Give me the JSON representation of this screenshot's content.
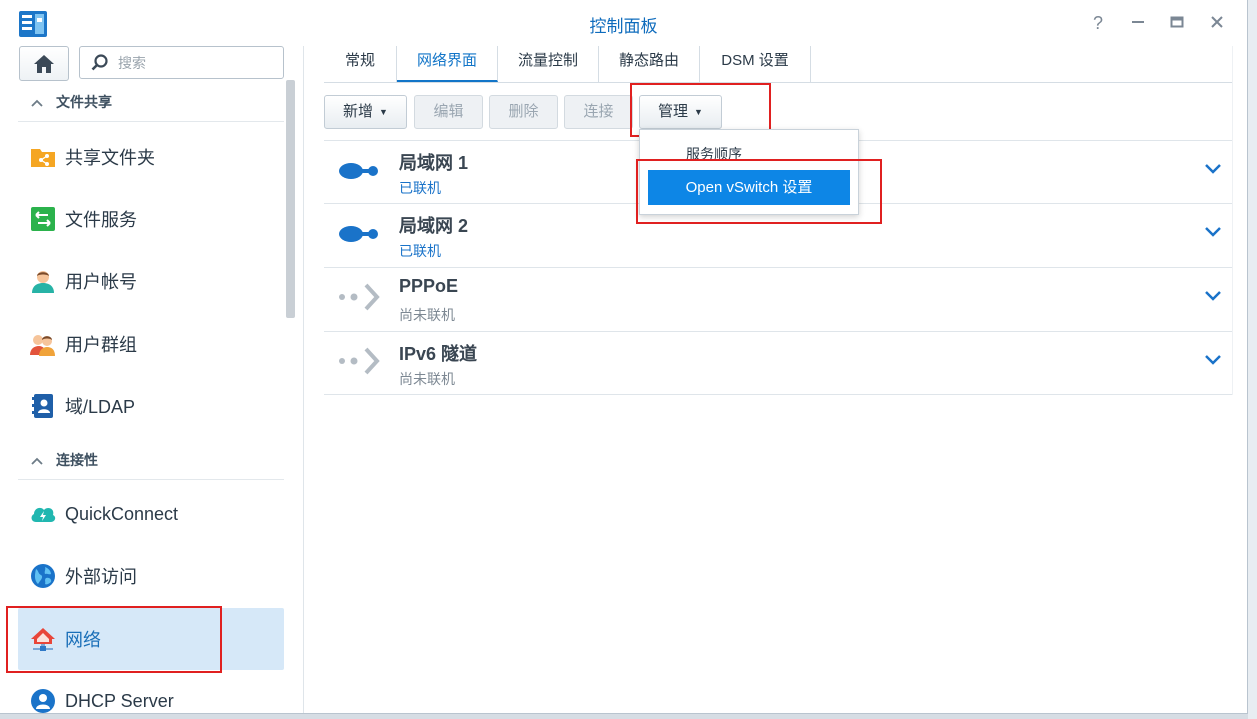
{
  "window": {
    "title": "控制面板"
  },
  "sidebar": {
    "search_placeholder": "搜索",
    "sections": [
      {
        "label": "文件共享"
      },
      {
        "label": "连接性"
      }
    ],
    "items": [
      {
        "label": "共享文件夹",
        "icon": "shared-folder-icon"
      },
      {
        "label": "文件服务",
        "icon": "file-services-icon"
      },
      {
        "label": "用户帐号",
        "icon": "user-icon"
      },
      {
        "label": "用户群组",
        "icon": "user-group-icon"
      },
      {
        "label": "域/LDAP",
        "icon": "domain-ldap-icon"
      },
      {
        "label": "QuickConnect",
        "icon": "quickconnect-icon"
      },
      {
        "label": "外部访问",
        "icon": "globe-icon"
      },
      {
        "label": "网络",
        "icon": "network-house-icon",
        "active": true
      },
      {
        "label": "DHCP Server",
        "icon": "dhcp-server-icon"
      }
    ]
  },
  "tabs": [
    {
      "label": "常规"
    },
    {
      "label": "网络界面",
      "active": true
    },
    {
      "label": "流量控制"
    },
    {
      "label": "静态路由"
    },
    {
      "label": "DSM 设置"
    }
  ],
  "toolbar": {
    "create": "新增",
    "edit": "编辑",
    "delete": "删除",
    "connect": "连接",
    "manage": "管理"
  },
  "dropdown": {
    "items": [
      "服务顺序",
      "Open vSwitch 设置"
    ]
  },
  "interfaces": [
    {
      "name": "局域网 1",
      "status": "已联机",
      "connected": true
    },
    {
      "name": "局域网 2",
      "status": "已联机",
      "connected": true
    },
    {
      "name": "PPPoE",
      "status": "尚未联机",
      "connected": false
    },
    {
      "name": "IPv6 隧道",
      "status": "尚未联机",
      "connected": false
    }
  ],
  "colors": {
    "accent": "#1275c8",
    "connected_status": "#1a73c9",
    "disconnected_status": "#7d8893",
    "highlight_border": "#e02020",
    "menu_highlight": "#0d86e6"
  }
}
